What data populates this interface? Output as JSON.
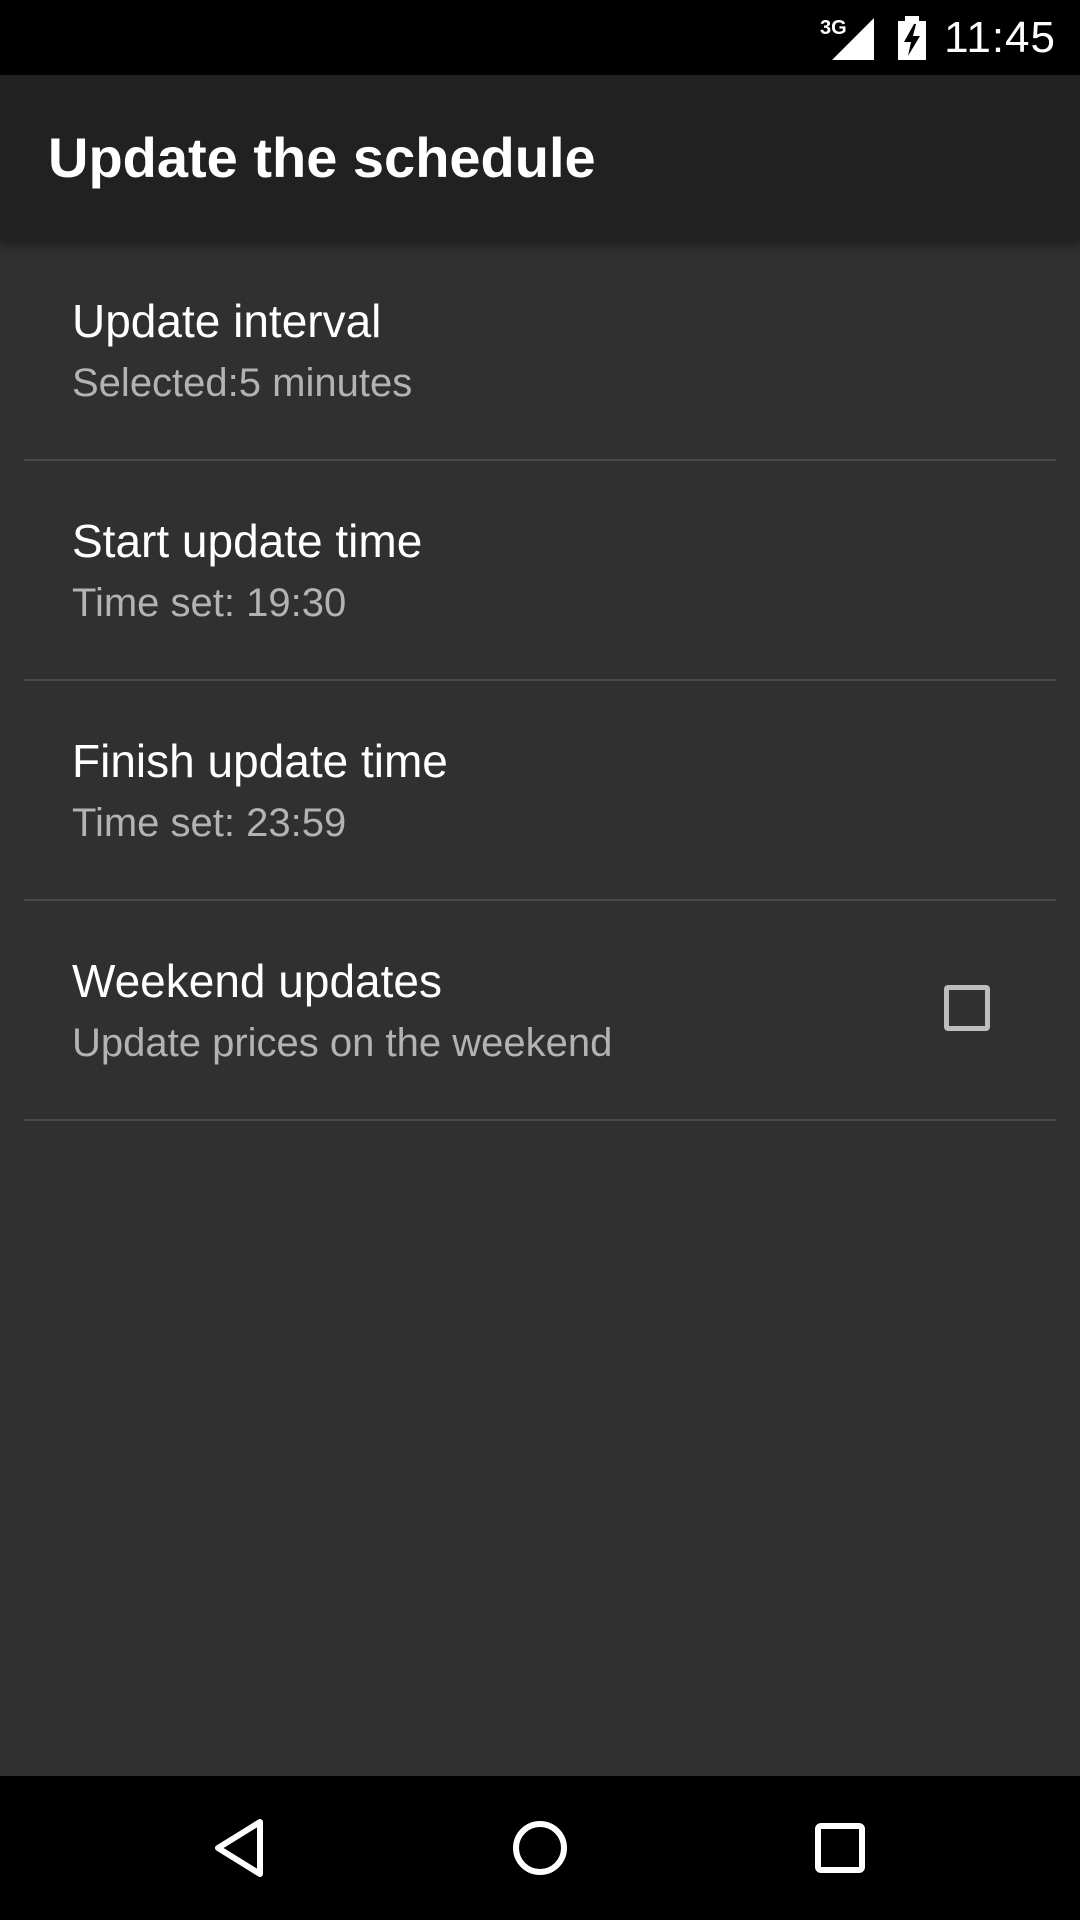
{
  "status_bar": {
    "network": "3G",
    "time": "11:45",
    "icons": [
      "cell-signal-icon",
      "battery-charging-icon"
    ]
  },
  "app_bar": {
    "title": "Update the schedule"
  },
  "preferences": [
    {
      "title": "Update interval",
      "summary": "Selected:5 minutes"
    },
    {
      "title": "Start update time",
      "summary": "Time set: 19:30"
    },
    {
      "title": "Finish update time",
      "summary": "Time set: 23:59"
    },
    {
      "title": "Weekend updates",
      "summary": "Update prices on the weekend",
      "checked": false
    }
  ],
  "nav_bar": {
    "icons": [
      "back-icon",
      "home-icon",
      "recents-icon"
    ]
  },
  "colors": {
    "background": "#303030",
    "app_bar": "#212121",
    "status_bar": "#000000",
    "nav_bar": "#000000",
    "title_text": "#ffffff",
    "summary_text": "#b3b3b3",
    "divider": "#4a4a4a",
    "checkbox_border": "#bdbdbd"
  }
}
